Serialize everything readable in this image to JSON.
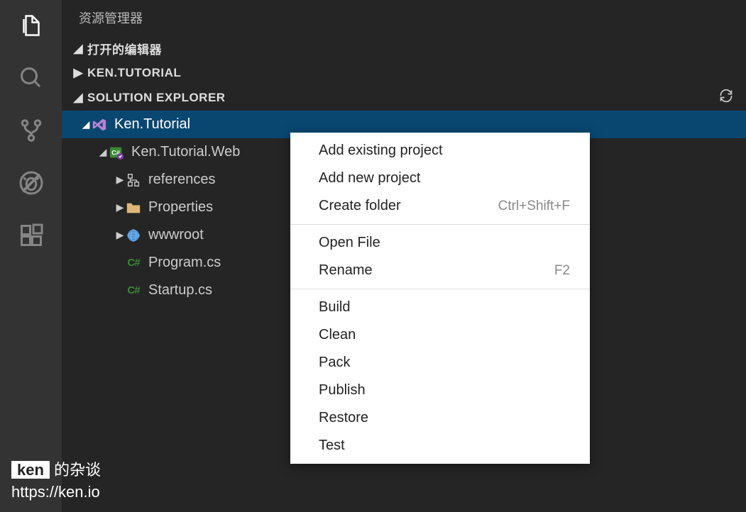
{
  "sidebar_title": "资源管理器",
  "sections": {
    "open_editors": "打开的编辑器",
    "project_root": "KEN.TUTORIAL",
    "solution_explorer": "SOLUTION EXPLORER"
  },
  "tree": {
    "solution": "Ken.Tutorial",
    "project": "Ken.Tutorial.Web",
    "references": "references",
    "properties": "Properties",
    "wwwroot": "wwwroot",
    "program_cs": "Program.cs",
    "startup_cs": "Startup.cs"
  },
  "context_menu": {
    "add_existing": "Add existing project",
    "add_new": "Add new project",
    "create_folder": "Create folder",
    "create_folder_shortcut": "Ctrl+Shift+F",
    "open_file": "Open File",
    "rename": "Rename",
    "rename_shortcut": "F2",
    "build": "Build",
    "clean": "Clean",
    "pack": "Pack",
    "publish": "Publish",
    "restore": "Restore",
    "test": "Test"
  },
  "watermark": {
    "name": "ken",
    "tagline": "的杂谈",
    "url": "https://ken.io"
  },
  "colors": {
    "activity_bar": "#333333",
    "sidebar_bg": "#252526",
    "selected_bg": "#094771",
    "cs_green": "#388a34"
  }
}
